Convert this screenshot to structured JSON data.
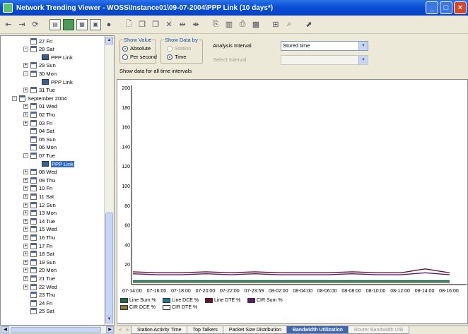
{
  "window": {
    "title": "Network Trending Viewer - WOSS\\Instance01\\09-07-2004\\PPP Link (10 days*)",
    "buttons": [
      "_",
      "□",
      "×"
    ]
  },
  "toolbar": {
    "icons": [
      "back-icon",
      "forward-icon",
      "refresh-icon",
      "view-1-icon",
      "view-2-icon",
      "view-3-icon",
      "view-4-icon",
      "record-icon",
      "new-icon",
      "open-icon",
      "save-icon",
      "delete-icon",
      "expand-icon",
      "collapse-icon",
      "copy-icon",
      "paste-icon",
      "print-icon",
      "chart-icon",
      "zoom-icon",
      "find-icon",
      "export-icon"
    ]
  },
  "tree": {
    "items": [
      {
        "label": "27 Fri",
        "level": 3,
        "expander": "",
        "icon": "calendar",
        "selected": false
      },
      {
        "label": "28 Sat",
        "level": 3,
        "expander": "-",
        "icon": "calendar",
        "selected": false
      },
      {
        "label": "PPP Link",
        "level": 4,
        "expander": "",
        "icon": "link",
        "selected": false
      },
      {
        "label": "29 Sun",
        "level": 3,
        "expander": "+",
        "icon": "calendar",
        "selected": false
      },
      {
        "label": "30 Mon",
        "level": 3,
        "expander": "-",
        "icon": "calendar",
        "selected": false
      },
      {
        "label": "PPP Link",
        "level": 4,
        "expander": "",
        "icon": "link",
        "selected": false
      },
      {
        "label": "31 Tue",
        "level": 3,
        "expander": "+",
        "icon": "calendar",
        "selected": false
      },
      {
        "label": "September 2004",
        "level": 2,
        "expander": "-",
        "icon": "calendar-big",
        "selected": false
      },
      {
        "label": "01 Wed",
        "level": 3,
        "expander": "+",
        "icon": "calendar",
        "selected": false
      },
      {
        "label": "02 Thu",
        "level": 3,
        "expander": "+",
        "icon": "calendar",
        "selected": false
      },
      {
        "label": "03 Fri",
        "level": 3,
        "expander": "+",
        "icon": "calendar",
        "selected": false
      },
      {
        "label": "04 Sat",
        "level": 3,
        "expander": "",
        "icon": "calendar",
        "selected": false
      },
      {
        "label": "05 Sun",
        "level": 3,
        "expander": "",
        "icon": "calendar",
        "selected": false
      },
      {
        "label": "06 Mon",
        "level": 3,
        "expander": "",
        "icon": "calendar",
        "selected": false
      },
      {
        "label": "07 Tue",
        "level": 3,
        "expander": "-",
        "icon": "calendar",
        "selected": false
      },
      {
        "label": "PPP Link",
        "level": 4,
        "expander": "",
        "icon": "link",
        "selected": true
      },
      {
        "label": "08 Wed",
        "level": 3,
        "expander": "+",
        "icon": "calendar",
        "selected": false
      },
      {
        "label": "09 Thu",
        "level": 3,
        "expander": "+",
        "icon": "calendar",
        "selected": false
      },
      {
        "label": "10 Fri",
        "level": 3,
        "expander": "+",
        "icon": "calendar",
        "selected": false
      },
      {
        "label": "11 Sat",
        "level": 3,
        "expander": "+",
        "icon": "calendar",
        "selected": false
      },
      {
        "label": "12 Sun",
        "level": 3,
        "expander": "+",
        "icon": "calendar",
        "selected": false
      },
      {
        "label": "13 Mon",
        "level": 3,
        "expander": "+",
        "icon": "calendar",
        "selected": false
      },
      {
        "label": "14 Tue",
        "level": 3,
        "expander": "+",
        "icon": "calendar",
        "selected": false
      },
      {
        "label": "15 Wed",
        "level": 3,
        "expander": "+",
        "icon": "calendar",
        "selected": false
      },
      {
        "label": "16 Thu",
        "level": 3,
        "expander": "+",
        "icon": "calendar",
        "selected": false
      },
      {
        "label": "17 Fri",
        "level": 3,
        "expander": "+",
        "icon": "calendar",
        "selected": false
      },
      {
        "label": "18 Sat",
        "level": 3,
        "expander": "+",
        "icon": "calendar",
        "selected": false
      },
      {
        "label": "19 Sun",
        "level": 3,
        "expander": "+",
        "icon": "calendar",
        "selected": false
      },
      {
        "label": "20 Mon",
        "level": 3,
        "expander": "+",
        "icon": "calendar",
        "selected": false
      },
      {
        "label": "21 Tue",
        "level": 3,
        "expander": "+",
        "icon": "calendar",
        "selected": false
      },
      {
        "label": "22 Wed",
        "level": 3,
        "expander": "+",
        "icon": "calendar",
        "selected": false
      },
      {
        "label": "23 Thu",
        "level": 3,
        "expander": "",
        "icon": "calendar",
        "selected": false
      },
      {
        "label": "24 Fri",
        "level": 3,
        "expander": "",
        "icon": "calendar",
        "selected": false
      },
      {
        "label": "25 Sat",
        "level": 3,
        "expander": "",
        "icon": "calendar",
        "selected": false
      }
    ]
  },
  "options": {
    "show_value": {
      "legend": "Show Value",
      "absolute": "Absolute",
      "per_second": "Per second",
      "selected": "absolute"
    },
    "show_data_by": {
      "legend": "Show Data by",
      "station": "Station",
      "time": "Time",
      "selected": "time"
    },
    "analysis_interval_label": "Analysis Interval",
    "analysis_interval_value": "Stored time",
    "select_interval_label": "Select Interval",
    "select_interval_value": "",
    "status": "Show data for all time intervals"
  },
  "chart_data": {
    "type": "line",
    "title": "",
    "xlabel": "",
    "ylabel": "",
    "ylim": [
      0,
      200
    ],
    "yticks": [
      20,
      40,
      60,
      80,
      100,
      120,
      140,
      160,
      180,
      200
    ],
    "x": [
      "07-14:00",
      "07-16:00",
      "07-18:00",
      "07-20:00",
      "07-22:00",
      "07-23:59",
      "08-02:00",
      "08-04:00",
      "08-06:00",
      "08-08:00",
      "08-10:00",
      "08-12:00",
      "08-14:00",
      "08-16:00"
    ],
    "grid": false,
    "legend_position": "bottom",
    "series": [
      {
        "name": "Line Sum %",
        "color": "#1f6a3a",
        "values": [
          4,
          4,
          4,
          4,
          4,
          4,
          4,
          4,
          4,
          4,
          4,
          4,
          4,
          4
        ]
      },
      {
        "name": "Line DCE %",
        "color": "#1c7a8a",
        "values": [
          3,
          3,
          3,
          3,
          3,
          3,
          3,
          3,
          3,
          3,
          3,
          3,
          3,
          3
        ]
      },
      {
        "name": "Line DTE %",
        "color": "#6a1034",
        "values": [
          13,
          12,
          12,
          13,
          12,
          13,
          12,
          12,
          12,
          13,
          12,
          12,
          16,
          12
        ]
      },
      {
        "name": "CIR Sum %",
        "color": "#5a1a72",
        "values": [
          11,
          10,
          10,
          11,
          10,
          11,
          10,
          10,
          10,
          11,
          10,
          10,
          12,
          10
        ]
      },
      {
        "name": "CIR DCE %",
        "color": "#8a7a3a",
        "values": [
          2,
          2,
          2,
          2,
          2,
          2,
          2,
          2,
          2,
          2,
          2,
          2,
          2,
          2
        ]
      },
      {
        "name": "CIR DTE %",
        "color": "#f2f2f2",
        "values": [
          1,
          1,
          1,
          1,
          1,
          1,
          1,
          1,
          1,
          1,
          1,
          1,
          1,
          1
        ]
      }
    ]
  },
  "tabs": {
    "items": [
      "Station Activity Time",
      "Top Talkers",
      "Packet Size Distribution",
      "Bandwidth Utilization",
      "Router Bandwidth Utili"
    ],
    "active": 3
  }
}
